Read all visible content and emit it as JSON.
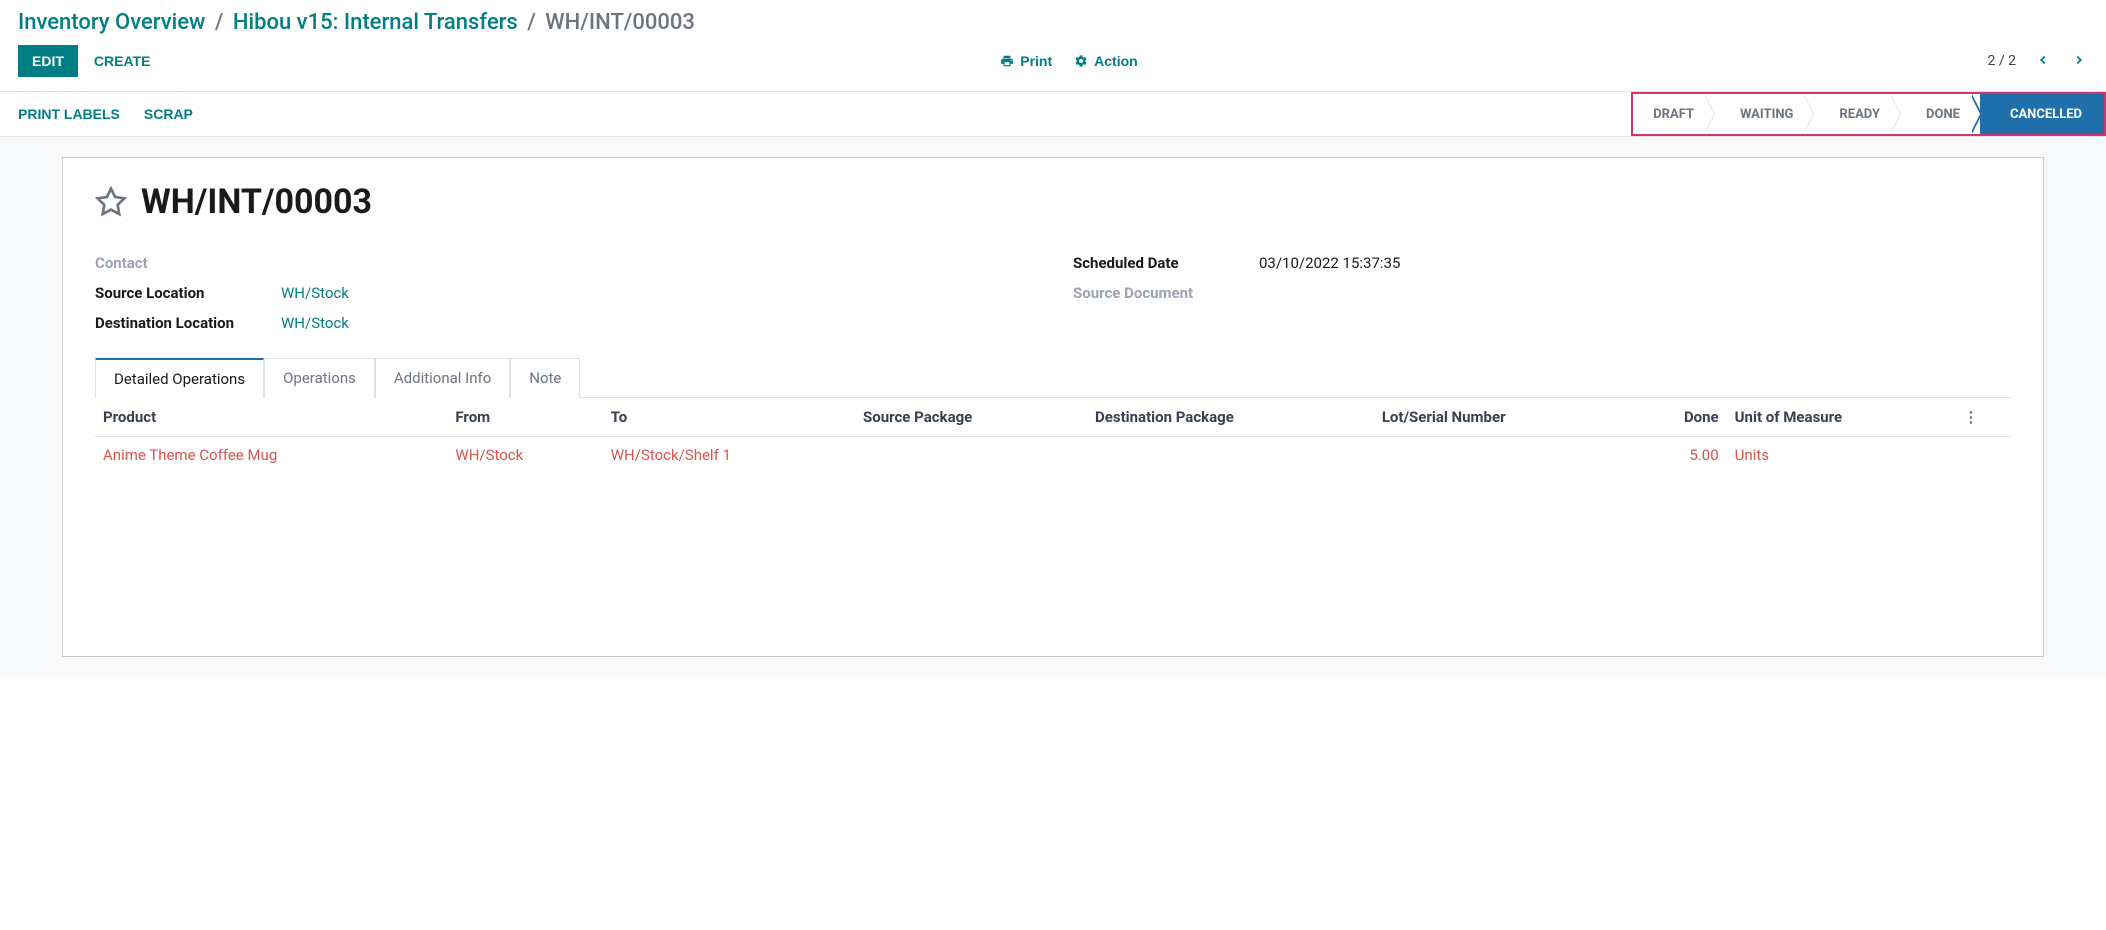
{
  "breadcrumb": {
    "items": [
      {
        "label": "Inventory Overview"
      },
      {
        "label": "Hibou v15: Internal Transfers"
      }
    ],
    "current": "WH/INT/00003"
  },
  "toolbar": {
    "edit": "EDIT",
    "create": "CREATE",
    "print": "Print",
    "action": "Action",
    "pager": "2 / 2"
  },
  "actionbar": {
    "print_labels": "PRINT LABELS",
    "scrap": "SCRAP"
  },
  "status": {
    "steps": [
      "DRAFT",
      "WAITING",
      "READY",
      "DONE",
      "CANCELLED"
    ],
    "active": "CANCELLED"
  },
  "record": {
    "title": "WH/INT/00003",
    "fields": {
      "contact_label": "Contact",
      "contact_value": "",
      "source_loc_label": "Source Location",
      "source_loc_value": "WH/Stock",
      "dest_loc_label": "Destination Location",
      "dest_loc_value": "WH/Stock",
      "scheduled_date_label": "Scheduled Date",
      "scheduled_date_value": "03/10/2022 15:37:35",
      "source_doc_label": "Source Document",
      "source_doc_value": ""
    }
  },
  "tabs": {
    "items": [
      "Detailed Operations",
      "Operations",
      "Additional Info",
      "Note"
    ],
    "active": "Detailed Operations"
  },
  "table": {
    "headers": {
      "product": "Product",
      "from": "From",
      "to": "To",
      "source_package": "Source Package",
      "dest_package": "Destination Package",
      "lot": "Lot/Serial Number",
      "done": "Done",
      "uom": "Unit of Measure"
    },
    "rows": [
      {
        "product": "Anime Theme Coffee Mug",
        "from": "WH/Stock",
        "to": "WH/Stock/Shelf 1",
        "source_package": "",
        "dest_package": "",
        "lot": "",
        "done": "5.00",
        "uom": "Units"
      }
    ]
  }
}
